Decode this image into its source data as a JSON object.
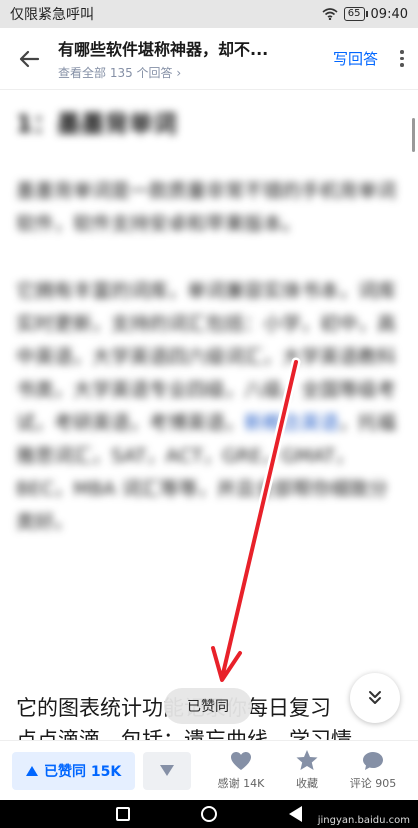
{
  "status_bar": {
    "left_text": "仅限紧急呼叫",
    "battery": "65",
    "time": "09:40"
  },
  "header": {
    "title": "有哪些软件堪称神器，却不...",
    "subtitle": "查看全部 135 个回答",
    "answer_label": "写回答"
  },
  "content": {
    "heading": "1：墨墨背单词",
    "para1": "墨墨背单词是一款质量非常不错的手机背单词软件，软件支持安卓和苹果版本。",
    "para2_a": "它拥有丰富的词库，单词兼容实体书本，词库实时更新，支持的词汇包括：小学，初中，高中英语，大学英语四六级词汇，大学英语教科书类，大学英语专业四级，八级，全国等级考试，考研英语，考博英语，",
    "para2_link": "新概念英语",
    "para2_b": "，托福雅思词汇，SAT，ACT，GRE，GMAT，BEC，MBA 词汇等等，并且全部帮你细致分类好。",
    "para3": "它的图表统计功能记录你每日复习",
    "para3_line2": "点点滴滴，包括：遗忘曲线，学习情"
  },
  "toast": "已赞同",
  "action_bar": {
    "upvote_label": "已赞同 15K",
    "thanks_label": "感谢 14K",
    "favorite_label": "收藏",
    "comment_label": "评论 905"
  },
  "watermark": "jingyan.baidu.com",
  "colors": {
    "accent": "#0066ff",
    "upvote_bg": "#e5efff",
    "arrow": "#e8212a"
  },
  "icons": [
    "back-arrow-icon",
    "more-vertical-icon",
    "chevron-right-icon",
    "heart-icon",
    "star-icon",
    "comment-icon",
    "double-chevron-down-icon",
    "triangle-up-icon",
    "triangle-down-icon"
  ]
}
